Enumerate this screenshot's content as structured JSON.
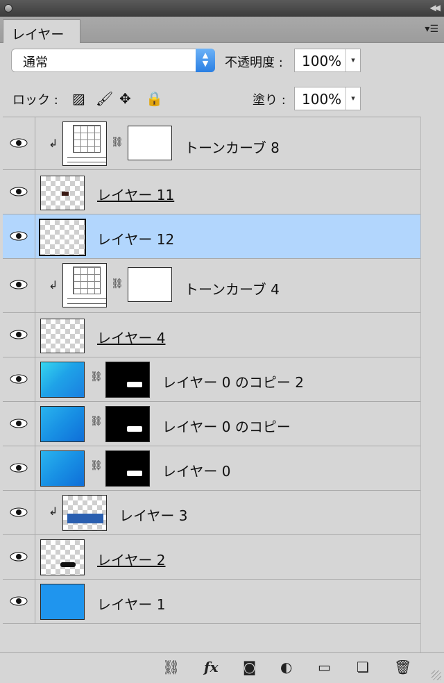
{
  "panel": {
    "tab_label": "レイヤー",
    "blend_mode": "通常",
    "opacity_label": "不透明度 :",
    "opacity_value": "100%",
    "lock_label": "ロック :",
    "fill_label": "塗り :",
    "fill_value": "100%"
  },
  "layers": [
    {
      "name": "トーンカーブ 8",
      "type": "adjustment",
      "clipped": true,
      "selected": false,
      "underlined": false
    },
    {
      "name": "レイヤー 11",
      "type": "pixel-checker",
      "clipped": false,
      "selected": false,
      "underlined": true
    },
    {
      "name": "レイヤー 12",
      "type": "pixel-checker",
      "clipped": false,
      "selected": true,
      "underlined": false
    },
    {
      "name": "トーンカーブ 4",
      "type": "adjustment",
      "clipped": true,
      "selected": false,
      "underlined": false
    },
    {
      "name": "レイヤー 4",
      "type": "pixel-checker",
      "clipped": false,
      "selected": false,
      "underlined": true
    },
    {
      "name": "レイヤー 0 のコピー 2",
      "type": "masked-photo",
      "clipped": false,
      "selected": false,
      "underlined": false
    },
    {
      "name": "レイヤー 0 のコピー",
      "type": "masked-photo",
      "clipped": false,
      "selected": false,
      "underlined": false
    },
    {
      "name": "レイヤー 0",
      "type": "masked-photo",
      "clipped": false,
      "selected": false,
      "underlined": false
    },
    {
      "name": "レイヤー 3",
      "type": "pixel-checker",
      "clipped": true,
      "selected": false,
      "underlined": false
    },
    {
      "name": "レイヤー 2",
      "type": "pixel-checker",
      "clipped": false,
      "selected": false,
      "underlined": true
    },
    {
      "name": "レイヤー 1",
      "type": "pixel-solid",
      "clipped": false,
      "selected": false,
      "underlined": false
    }
  ],
  "bottom_icons": {
    "fx": "fx"
  },
  "colors": {
    "selection": "#b2d6fd",
    "panel_bg": "#d6d6d6",
    "accent": "#2a7fe3"
  }
}
